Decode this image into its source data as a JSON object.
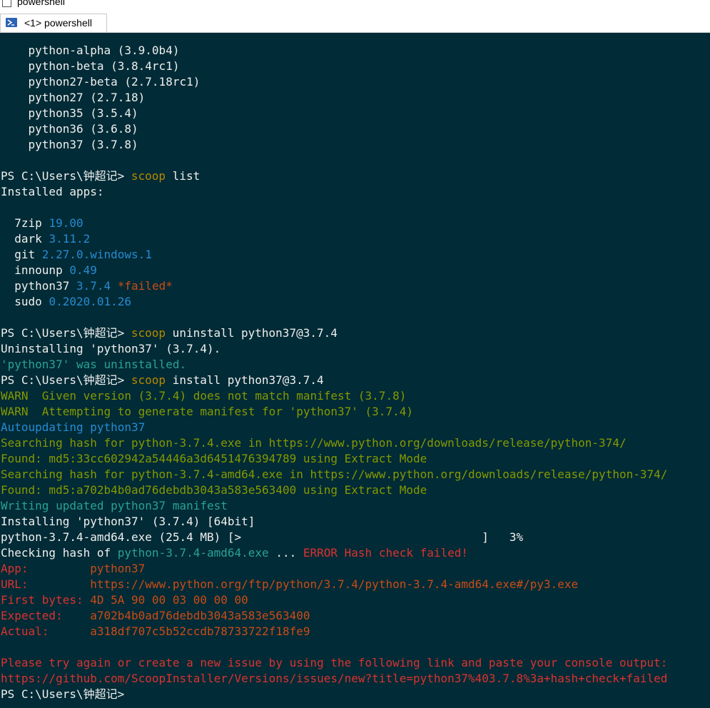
{
  "window": {
    "title": "powershell"
  },
  "tab": {
    "label": "<1> powershell"
  },
  "colors": {
    "background": "#012b36",
    "text": "#f0f0f0",
    "command": "#b58900",
    "version": "#268bd2",
    "info": "#2aa198",
    "warn": "#859900",
    "error": "#dc322f",
    "highlight": "#cb4b16"
  },
  "terminal": {
    "lines": [
      [
        {
          "t": "    python-alpha (3.9.0b4)",
          "c": "w"
        }
      ],
      [
        {
          "t": "    python-beta (3.8.4rc1)",
          "c": "w"
        }
      ],
      [
        {
          "t": "    python27-beta (2.7.18rc1)",
          "c": "w"
        }
      ],
      [
        {
          "t": "    python27 (2.7.18)",
          "c": "w"
        }
      ],
      [
        {
          "t": "    python35 (3.5.4)",
          "c": "w"
        }
      ],
      [
        {
          "t": "    python36 (3.6.8)",
          "c": "w"
        }
      ],
      [
        {
          "t": "    python37 (3.7.8)",
          "c": "w"
        }
      ],
      [],
      [
        {
          "t": "PS C:\\Users\\钟超记> ",
          "c": "w"
        },
        {
          "t": "scoop",
          "c": "y"
        },
        {
          "t": " list",
          "c": "w"
        }
      ],
      [
        {
          "t": "Installed apps:",
          "c": "w"
        }
      ],
      [],
      [
        {
          "t": "  7zip ",
          "c": "w"
        },
        {
          "t": "19.00",
          "c": "t"
        }
      ],
      [
        {
          "t": "  dark ",
          "c": "w"
        },
        {
          "t": "3.11.2",
          "c": "t"
        }
      ],
      [
        {
          "t": "  git ",
          "c": "w"
        },
        {
          "t": "2.27.0.windows.1",
          "c": "t"
        }
      ],
      [
        {
          "t": "  innounp ",
          "c": "w"
        },
        {
          "t": "0.49",
          "c": "t"
        }
      ],
      [
        {
          "t": "  python37 ",
          "c": "w"
        },
        {
          "t": "3.7.4",
          "c": "t"
        },
        {
          "t": " *failed*",
          "c": "o"
        }
      ],
      [
        {
          "t": "  sudo ",
          "c": "w"
        },
        {
          "t": "0.2020.01.26",
          "c": "t"
        }
      ],
      [],
      [
        {
          "t": "PS C:\\Users\\钟超记> ",
          "c": "w"
        },
        {
          "t": "scoop",
          "c": "y"
        },
        {
          "t": " uninstall python37@3.7.4",
          "c": "w"
        }
      ],
      [
        {
          "t": "Uninstalling 'python37' (3.7.4).",
          "c": "w"
        }
      ],
      [
        {
          "t": "'python37' was uninstalled.",
          "c": "c"
        }
      ],
      [
        {
          "t": "PS C:\\Users\\钟超记> ",
          "c": "w"
        },
        {
          "t": "scoop",
          "c": "y"
        },
        {
          "t": " install python37@3.7.4",
          "c": "w"
        }
      ],
      [
        {
          "t": "WARN  Given version (3.7.4) does not match manifest (3.7.8)",
          "c": "g"
        }
      ],
      [
        {
          "t": "WARN  Attempting to generate manifest for 'python37' (3.7.4)",
          "c": "g"
        }
      ],
      [
        {
          "t": "Autoupdating python37",
          "c": "t"
        }
      ],
      [
        {
          "t": "Searching hash for python-3.7.4.exe in https://www.python.org/downloads/release/python-374/",
          "c": "g"
        }
      ],
      [
        {
          "t": "Found: md5:33cc602942a54446a3d6451476394789 using Extract Mode",
          "c": "g"
        }
      ],
      [
        {
          "t": "Searching hash for python-3.7.4-amd64.exe in https://www.python.org/downloads/release/python-374/",
          "c": "g"
        }
      ],
      [
        {
          "t": "Found: md5:a702b4b0ad76debdb3043a583e563400 using Extract Mode",
          "c": "g"
        }
      ],
      [
        {
          "t": "Writing updated python37 manifest",
          "c": "c"
        }
      ],
      [
        {
          "t": "Installing 'python37' (3.7.4) [64bit]",
          "c": "w"
        }
      ],
      [
        {
          "t": "python-3.7.4-amd64.exe (25.4 MB) [>                                   ]   3%",
          "c": "w"
        }
      ],
      [
        {
          "t": "Checking hash of ",
          "c": "w"
        },
        {
          "t": "python-3.7.4-amd64.exe",
          "c": "c"
        },
        {
          "t": " ... ",
          "c": "w"
        },
        {
          "t": "ERROR Hash check failed!",
          "c": "r"
        }
      ],
      [
        {
          "t": "App:         ",
          "c": "r"
        },
        {
          "t": "python37",
          "c": "o"
        }
      ],
      [
        {
          "t": "URL:         ",
          "c": "r"
        },
        {
          "t": "https://www.python.org/ftp/python/3.7.4/python-3.7.4-amd64.exe#/py3.exe",
          "c": "o"
        }
      ],
      [
        {
          "t": "First bytes: ",
          "c": "r"
        },
        {
          "t": "4D 5A 90 00 03 00 00 00",
          "c": "o"
        }
      ],
      [
        {
          "t": "Expected:    ",
          "c": "r"
        },
        {
          "t": "a702b4b0ad76debdb3043a583e563400",
          "c": "o"
        }
      ],
      [
        {
          "t": "Actual:      ",
          "c": "r"
        },
        {
          "t": "a318df707c5b52ccdb78733722f18fe9",
          "c": "o"
        }
      ],
      [],
      [
        {
          "t": "Please try again or create a new issue by using the following link and paste your console output:",
          "c": "r"
        }
      ],
      [
        {
          "t": "https://github.com/ScoopInstaller/Versions/issues/new?title=python37%403.7.8%3a+hash+check+failed",
          "c": "r"
        }
      ],
      [
        {
          "t": "PS C:\\Users\\钟超记>",
          "c": "w"
        }
      ]
    ]
  }
}
